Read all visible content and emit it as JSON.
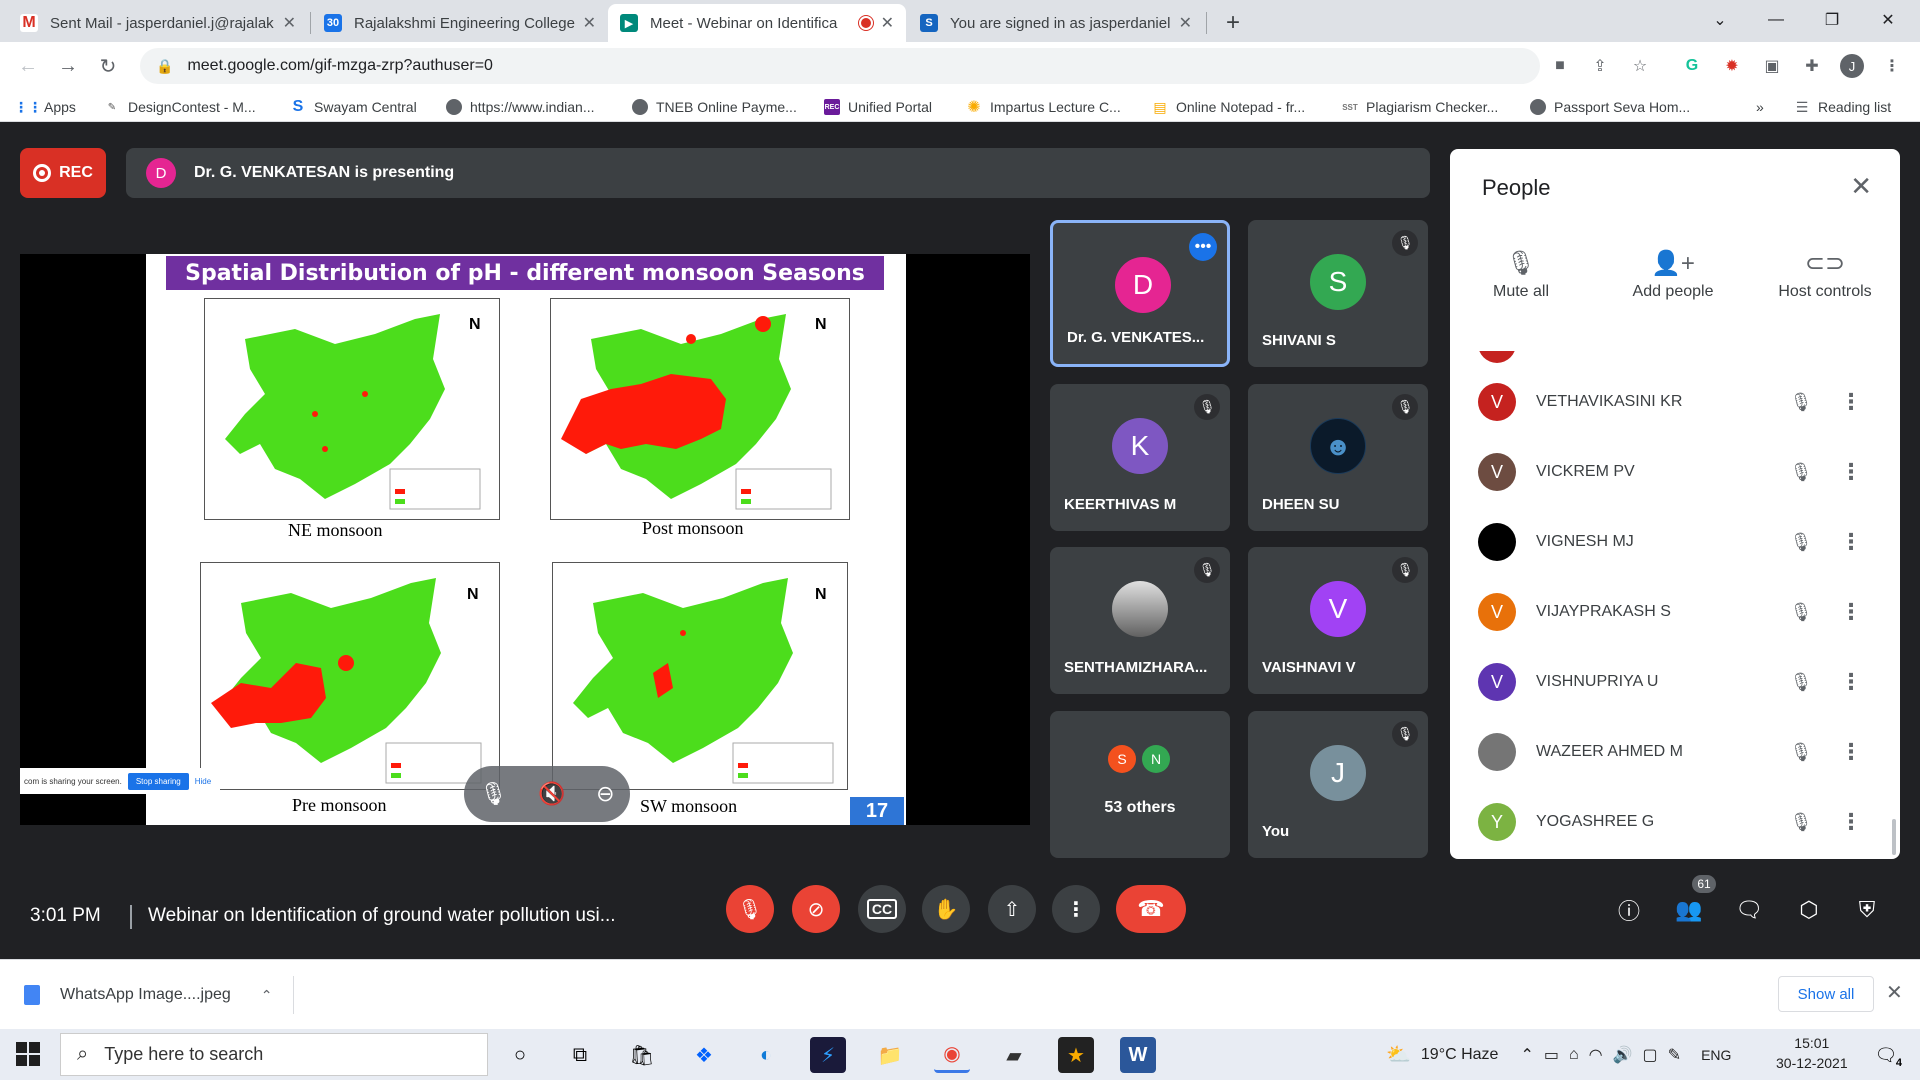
{
  "browser": {
    "tabs": [
      {
        "title": "Sent Mail - jasperdaniel.j@rajalak",
        "icon": "gmail-icon",
        "active": false
      },
      {
        "title": "Rajalakshmi Engineering College",
        "icon": "calendar-icon",
        "active": false
      },
      {
        "title": "Meet - Webinar on Identifica",
        "icon": "meet-icon",
        "active": true
      },
      {
        "title": "You are signed in as jasperdaniel",
        "icon": "s-icon",
        "active": false
      }
    ],
    "url": "meet.google.com/gif-mzga-zrp?authuser=0",
    "profile_initial": "J",
    "bookmarks": [
      "Apps",
      "DesignContest - M...",
      "Swayam Central",
      "https://www.indian...",
      "TNEB Online Payme...",
      "Unified Portal",
      "Impartus Lecture C...",
      "Online Notepad - fr...",
      "Plagiarism Checker...",
      "Passport Seva Hom..."
    ],
    "bookmark_overflow": "»",
    "reading_list": "Reading list"
  },
  "meet": {
    "rec_label": "REC",
    "presenter_initial": "D",
    "presenting_text": "Dr. G. VENKATESAN is presenting",
    "slide": {
      "title": "Spatial Distribution of pH - different monsoon Seasons",
      "maps": [
        "NE monsoon",
        "Post monsoon",
        "Pre monsoon",
        "SW monsoon"
      ],
      "slide_number": "17",
      "share_note": "com is sharing your screen.",
      "stop_sharing": "Stop sharing",
      "hide": "Hide"
    },
    "tiles": [
      {
        "initial": "D",
        "name": "Dr. G. VENKATES...",
        "color": "#e52592",
        "speaking": true
      },
      {
        "initial": "S",
        "name": "SHIVANI S",
        "color": "#33a852"
      },
      {
        "initial": "K",
        "name": "KEERTHIVAS M",
        "color": "#7e57c2"
      },
      {
        "initial": "",
        "name": "DHEEN SU",
        "color": "#0b1a2a"
      },
      {
        "initial": "",
        "name": "SENTHAMIZHARA...",
        "color": "#9e9e9e"
      },
      {
        "initial": "V",
        "name": "VAISHNAVI V",
        "color": "#a142f4"
      },
      {
        "initial": "J",
        "name": "You",
        "color": "#78909c"
      }
    ],
    "others": {
      "label": "53 others",
      "initials": [
        "S",
        "N"
      ]
    },
    "people_panel": {
      "title": "People",
      "actions": [
        "Mute all",
        "Add people",
        "Host controls"
      ],
      "participants": [
        {
          "initial": "V",
          "name": "VETHAVIKASINI KR",
          "color": "#c5221f"
        },
        {
          "initial": "V",
          "name": "VICKREM PV",
          "color": "#6d4c41"
        },
        {
          "initial": "",
          "name": "VIGNESH MJ",
          "color": "#000000"
        },
        {
          "initial": "V",
          "name": "VIJAYPRAKASH S",
          "color": "#e8710a"
        },
        {
          "initial": "V",
          "name": "VISHNUPRIYA U",
          "color": "#5e35b1"
        },
        {
          "initial": "",
          "name": "WAZEER AHMED M",
          "color": "#757575"
        },
        {
          "initial": "Y",
          "name": "YOGASHREE G",
          "color": "#7cb342"
        }
      ]
    },
    "bottom": {
      "time": "3:01 PM",
      "meeting_name": "Webinar on Identification of ground water pollution usi...",
      "participant_count": "61"
    }
  },
  "downloads": {
    "file": "WhatsApp Image....jpeg",
    "show_all": "Show all"
  },
  "taskbar": {
    "search_placeholder": "Type here to search",
    "weather": "19°C  Haze",
    "language": "ENG",
    "time": "15:01",
    "date": "30-12-2021",
    "notifications": "4"
  },
  "colors": {
    "meet_bg": "#202124",
    "accent": "#1a73e8",
    "danger": "#ea4335",
    "slide_title_bg": "#7030a0",
    "map_green": "#4cdd1c",
    "map_red": "#ff1a0a"
  }
}
